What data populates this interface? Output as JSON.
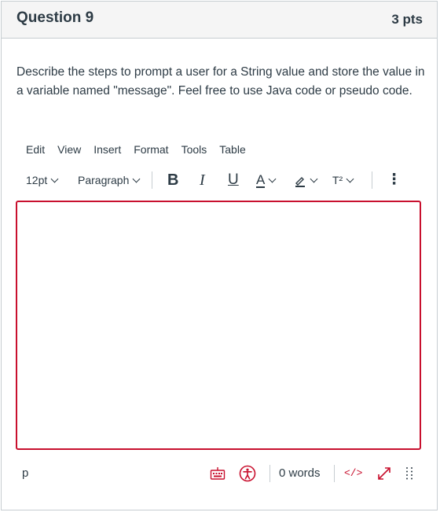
{
  "question": {
    "title": "Question 9",
    "points": "3 pts",
    "text": "Describe the steps to prompt a user for a String value and store the value in a variable named \"message\".  Feel free to use Java code or pseudo code."
  },
  "menubar": [
    "Edit",
    "View",
    "Insert",
    "Format",
    "Tools",
    "Table"
  ],
  "toolbar": {
    "font_size": "12pt",
    "block_format": "Paragraph",
    "bold_label": "B",
    "italic_label": "I",
    "underline_label": "U",
    "text_color_label": "A",
    "superscript_label": "T²",
    "more_label": "⋮"
  },
  "editor": {
    "content": ""
  },
  "statusbar": {
    "element_path": "p",
    "word_count": "0 words",
    "html_label": "</>"
  },
  "colors": {
    "accent": "#c8102e",
    "text": "#2d3b45",
    "border": "#c7cdd1",
    "header_bg": "#f5f5f5"
  }
}
